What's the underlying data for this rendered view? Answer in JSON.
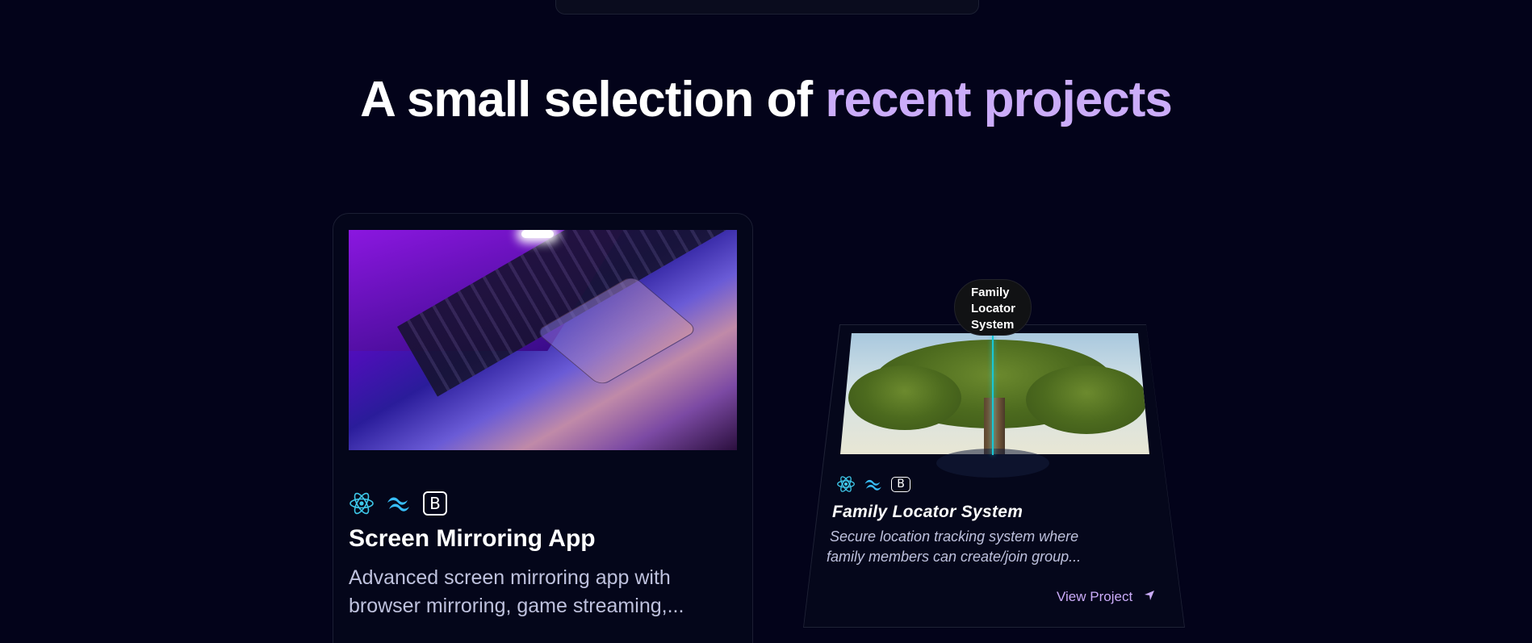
{
  "headline": {
    "part1": "A small selection of",
    "accent": "recent projects",
    "accent_color": "#cbacf9"
  },
  "projects": [
    {
      "title": "Screen Mirroring App",
      "description_line1": "Advanced screen mirroring app with",
      "description_line2": "browser mirroring, game streaming,...",
      "image": "laptop-photo",
      "tech_icons": [
        "react-icon",
        "tailwind-icon",
        "bootstrap-icon"
      ],
      "bootstrap_letter": "B"
    },
    {
      "title": "Family Locator System",
      "description_line1": "Secure location tracking system where",
      "description_line2": "family members can create/join group...",
      "image": "tree-photo",
      "tech_icons": [
        "react-icon",
        "tailwind-icon",
        "bootstrap-icon"
      ],
      "bootstrap_letter": "B",
      "tooltip_line1": "Family",
      "tooltip_line2": "Locator",
      "tooltip_line3": "System",
      "link_label": "View Project",
      "link_icon": "arrow-icon"
    }
  ],
  "colors": {
    "background": "#03031a",
    "react": "#3ec8ea",
    "tailwind": "#38bdf8",
    "line": "#18c7d6"
  }
}
